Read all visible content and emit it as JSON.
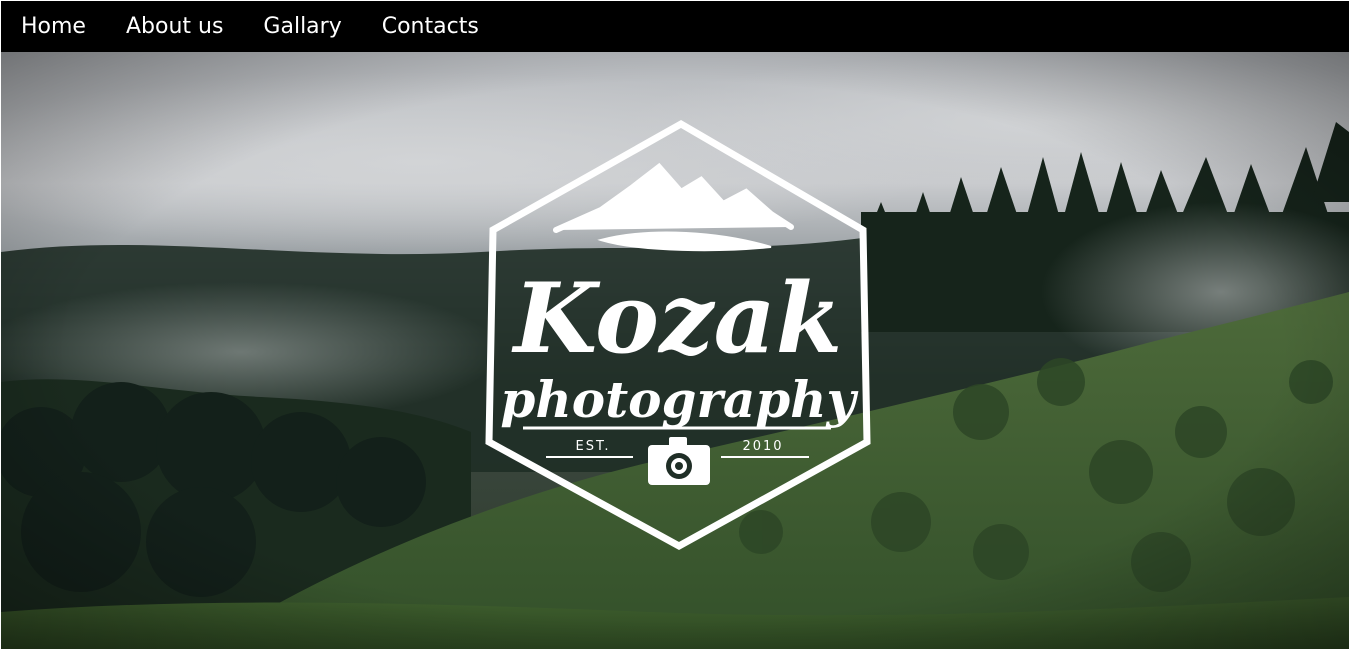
{
  "nav": {
    "items": [
      {
        "label": "Home"
      },
      {
        "label": "About us"
      },
      {
        "label": "Gallary"
      },
      {
        "label": "Contacts"
      }
    ]
  },
  "hero": {
    "logo": {
      "word1": "Kozak",
      "word2": "photography",
      "est_label": "EST.",
      "year": "2010",
      "icon": "camera-icon"
    }
  },
  "colors": {
    "nav_bg": "#000000",
    "nav_text": "#ffffff",
    "logo": "#ffffff"
  }
}
